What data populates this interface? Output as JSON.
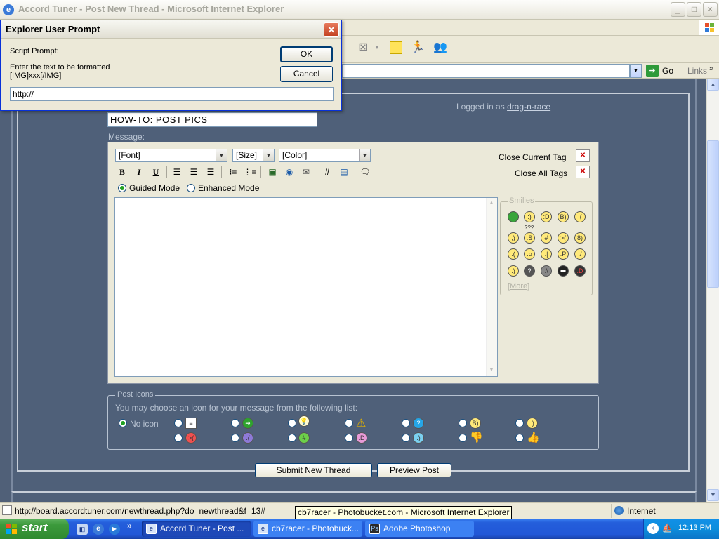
{
  "window": {
    "title": "Accord Tuner - Post New Thread - Microsoft Internet Explorer"
  },
  "addressbar": {
    "go_label": "Go",
    "links_label": "Links"
  },
  "dialog": {
    "title": "Explorer User Prompt",
    "script_prompt_label": "Script Prompt:",
    "message_line1": "Enter the text to be formatted",
    "message_line2": "[IMG]xxx[/IMG]",
    "input_value": "http://",
    "ok_label": "OK",
    "cancel_label": "Cancel"
  },
  "forum": {
    "logged_in_prefix": "Logged in as",
    "username": "drag-n-race",
    "title_value": "HOW-TO: POST PICS",
    "message_label": "Message:",
    "font_select": "[Font]",
    "size_select": "[Size]",
    "color_select": "[Color]",
    "close_current_tag": "Close Current Tag",
    "close_all_tags": "Close All Tags",
    "guided_mode": "Guided Mode",
    "enhanced_mode": "Enhanced Mode",
    "mode_selected": "Guided Mode",
    "format_buttons": [
      "B",
      "I",
      "U"
    ],
    "smilies_legend": "Smilies",
    "smilies_more": "[More]",
    "smilies_extra_label": "???",
    "post_icons_legend": "Post Icons",
    "post_icons_hint": "You may choose an icon for your message from the following list:",
    "no_icon_label": "No icon",
    "submit_label": "Submit New Thread",
    "preview_label": "Preview Post"
  },
  "statusbar": {
    "url": "http://board.accordtuner.com/newthread.php?do=newthread&f=13#",
    "zone": "Internet",
    "tooltip": "cb7racer - Photobucket.com - Microsoft Internet Explorer"
  },
  "taskbar": {
    "start_label": "start",
    "tasks": [
      {
        "label": "Accord Tuner - Post ..."
      },
      {
        "label": "cb7racer - Photobuck..."
      },
      {
        "label": "Adobe Photoshop"
      }
    ],
    "clock": "12:13 PM"
  },
  "colors": {
    "page_bg": "#506078",
    "editor_bg": "#ebe9d9",
    "taskbar_blue": "#245edb",
    "start_green": "#3c9a3c"
  }
}
